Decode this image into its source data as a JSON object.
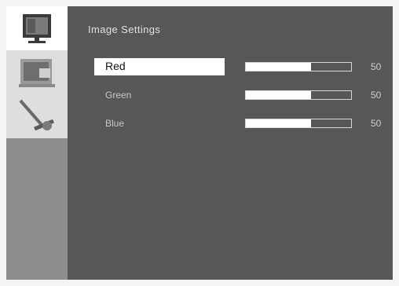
{
  "sidebar": {
    "items": [
      {
        "icon": "monitor-icon",
        "selected": true
      },
      {
        "icon": "screen-position-icon",
        "selected": false
      },
      {
        "icon": "tools-icon",
        "selected": false
      }
    ]
  },
  "panel": {
    "title": "Image Settings",
    "settings": [
      {
        "label": "Red",
        "value": "50",
        "level": 0.62,
        "selected": true
      },
      {
        "label": "Green",
        "value": "50",
        "level": 0.62,
        "selected": false
      },
      {
        "label": "Blue",
        "value": "50",
        "level": 0.62,
        "selected": false
      }
    ]
  },
  "colors": {
    "panel_bg": "#575757",
    "sidebar_bg": "#8d8d8d",
    "highlight": "#ffffff",
    "text": "#c8c8c8"
  }
}
